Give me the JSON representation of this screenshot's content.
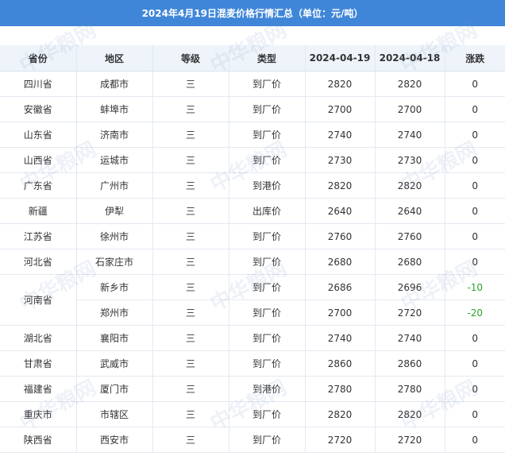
{
  "title": "2024年4月19日混麦价格行情汇总（单位：元/吨）",
  "watermark": "中华粮网",
  "headers": [
    "省份",
    "地区",
    "等级",
    "类型",
    "2024-04-19",
    "2024-04-18",
    "涨跌"
  ],
  "rows": [
    {
      "province": "四川省",
      "region": "成都市",
      "grade": "三",
      "type": "到厂价",
      "d19": "2820",
      "d18": "2820",
      "change": "0"
    },
    {
      "province": "安徽省",
      "region": "蚌埠市",
      "grade": "三",
      "type": "到厂价",
      "d19": "2700",
      "d18": "2700",
      "change": "0"
    },
    {
      "province": "山东省",
      "region": "济南市",
      "grade": "三",
      "type": "到厂价",
      "d19": "2740",
      "d18": "2740",
      "change": "0"
    },
    {
      "province": "山西省",
      "region": "运城市",
      "grade": "三",
      "type": "到厂价",
      "d19": "2730",
      "d18": "2730",
      "change": "0"
    },
    {
      "province": "广东省",
      "region": "广州市",
      "grade": "三",
      "type": "到港价",
      "d19": "2820",
      "d18": "2820",
      "change": "0"
    },
    {
      "province": "新疆",
      "region": "伊犁",
      "grade": "三",
      "type": "出库价",
      "d19": "2640",
      "d18": "2640",
      "change": "0"
    },
    {
      "province": "江苏省",
      "region": "徐州市",
      "grade": "三",
      "type": "到厂价",
      "d19": "2760",
      "d18": "2760",
      "change": "0"
    },
    {
      "province": "河北省",
      "region": "石家庄市",
      "grade": "三",
      "type": "到厂价",
      "d19": "2680",
      "d18": "2680",
      "change": "0"
    },
    {
      "province": "河南省",
      "region": "新乡市",
      "grade": "三",
      "type": "到厂价",
      "d19": "2686",
      "d18": "2696",
      "change": "-10"
    },
    {
      "province": "",
      "region": "郑州市",
      "grade": "三",
      "type": "到厂价",
      "d19": "2700",
      "d18": "2720",
      "change": "-20"
    },
    {
      "province": "湖北省",
      "region": "襄阳市",
      "grade": "三",
      "type": "到厂价",
      "d19": "2740",
      "d18": "2740",
      "change": "0"
    },
    {
      "province": "甘肃省",
      "region": "武威市",
      "grade": "三",
      "type": "到厂价",
      "d19": "2860",
      "d18": "2860",
      "change": "0"
    },
    {
      "province": "福建省",
      "region": "厦门市",
      "grade": "三",
      "type": "到港价",
      "d19": "2780",
      "d18": "2780",
      "change": "0"
    },
    {
      "province": "重庆市",
      "region": "市辖区",
      "grade": "三",
      "type": "到厂价",
      "d19": "2820",
      "d18": "2820",
      "change": "0"
    },
    {
      "province": "陕西省",
      "region": "西安市",
      "grade": "三",
      "type": "到厂价",
      "d19": "2720",
      "d18": "2720",
      "change": "0"
    }
  ],
  "colors": {
    "title_bg": "#3f86d8",
    "header_bg": "#eef4fa",
    "negative": "#2aa52a"
  }
}
